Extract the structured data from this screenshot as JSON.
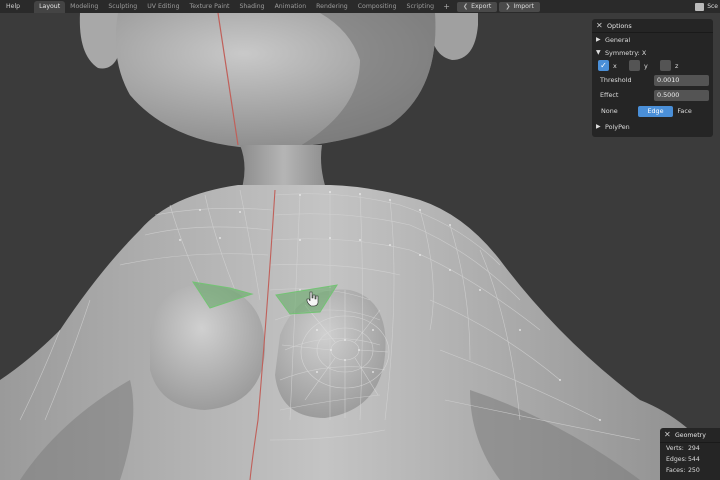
{
  "topbar": {
    "menu": [
      "Help"
    ],
    "tabs": [
      {
        "label": "Layout",
        "active": true
      },
      {
        "label": "Modeling"
      },
      {
        "label": "Sculpting"
      },
      {
        "label": "UV Editing"
      },
      {
        "label": "Texture Paint"
      },
      {
        "label": "Shading"
      },
      {
        "label": "Animation"
      },
      {
        "label": "Rendering"
      },
      {
        "label": "Compositing"
      },
      {
        "label": "Scripting"
      }
    ],
    "add_tab": "+",
    "export_label": "Export",
    "import_label": "Import",
    "scene_label": "Sce"
  },
  "options_panel": {
    "title": "Options",
    "general_label": "General",
    "symmetry_label": "Symmetry: X",
    "axes": [
      {
        "label": "x",
        "checked": true
      },
      {
        "label": "y",
        "checked": false
      },
      {
        "label": "z",
        "checked": false
      }
    ],
    "threshold_label": "Threshold",
    "threshold_value": "0.0010",
    "effect_label": "Effect",
    "effect_value": "0.5000",
    "modes": [
      "None",
      "Edge",
      "Face"
    ],
    "active_mode": "Edge",
    "polypen_label": "PolyPen"
  },
  "geometry_panel": {
    "title": "Geometry",
    "verts_label": "Verts:",
    "verts_value": "294",
    "edges_label": "Edges:",
    "edges_value": "544",
    "faces_label": "Faces:",
    "faces_value": "250"
  },
  "colors": {
    "accent": "#4a8fd8",
    "selection": "#5fa860",
    "seam": "#c0605a",
    "mesh": "#c2c2c2",
    "background": "#3b3b3b"
  }
}
